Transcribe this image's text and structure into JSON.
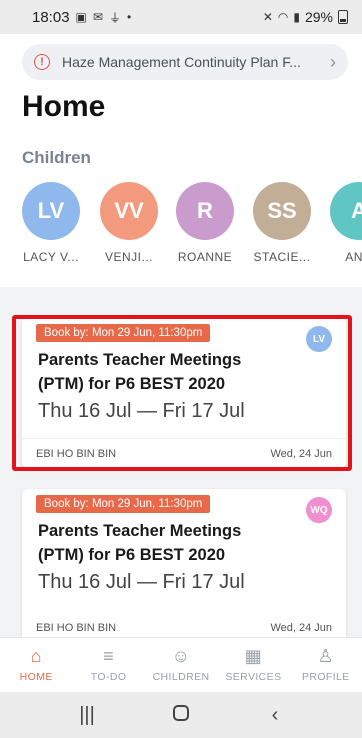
{
  "status_bar": {
    "time": "18:03",
    "battery": "29%"
  },
  "banner": {
    "text": "Haze Management Continuity Plan F...",
    "chevron": "›"
  },
  "page": {
    "title": "Home",
    "children_section_title": "Children"
  },
  "children": [
    {
      "initials": "LV",
      "name": "LACY V...",
      "color": "#8fb8ec"
    },
    {
      "initials": "VV",
      "name": "VENJI...",
      "color": "#f39a7e"
    },
    {
      "initials": "R",
      "name": "ROANNE",
      "color": "#c99ccd"
    },
    {
      "initials": "SS",
      "name": "STACIE...",
      "color": "#c2ad97"
    },
    {
      "initials": "A",
      "name": "ANG",
      "color": "#5fc6c3"
    }
  ],
  "cards": [
    {
      "badge": "Book by: Mon 29 Jun, 11:30pm",
      "avatar_initials": "LV",
      "avatar_color": "#8fb8ec",
      "title": "Parents Teacher Meetings (PTM) for P6 BEST 2020",
      "dates": "Thu 16 Jul — Fri 17 Jul",
      "author": "EBI HO BIN BIN",
      "posted": "Wed, 24 Jun"
    },
    {
      "badge": "Book by: Mon 29 Jun, 11:30pm",
      "avatar_initials": "WQ",
      "avatar_color": "#ef8fcf",
      "title": "Parents Teacher Meetings (PTM) for P6 BEST 2020",
      "dates": "Thu 16 Jul — Fri 17 Jul",
      "author": "EBI HO BIN BIN",
      "posted": "Wed, 24 Jun"
    }
  ],
  "bottom_nav": [
    {
      "label": "HOME",
      "icon": "home-icon",
      "active": true
    },
    {
      "label": "TO-DO",
      "icon": "list-icon",
      "active": false
    },
    {
      "label": "CHILDREN",
      "icon": "smiley-icon",
      "active": false
    },
    {
      "label": "SERVICES",
      "icon": "grid-icon",
      "active": false
    },
    {
      "label": "PROFILE",
      "icon": "person-icon",
      "active": false
    }
  ],
  "colors": {
    "accent": "#e8694a",
    "highlight": "#e3131b"
  }
}
